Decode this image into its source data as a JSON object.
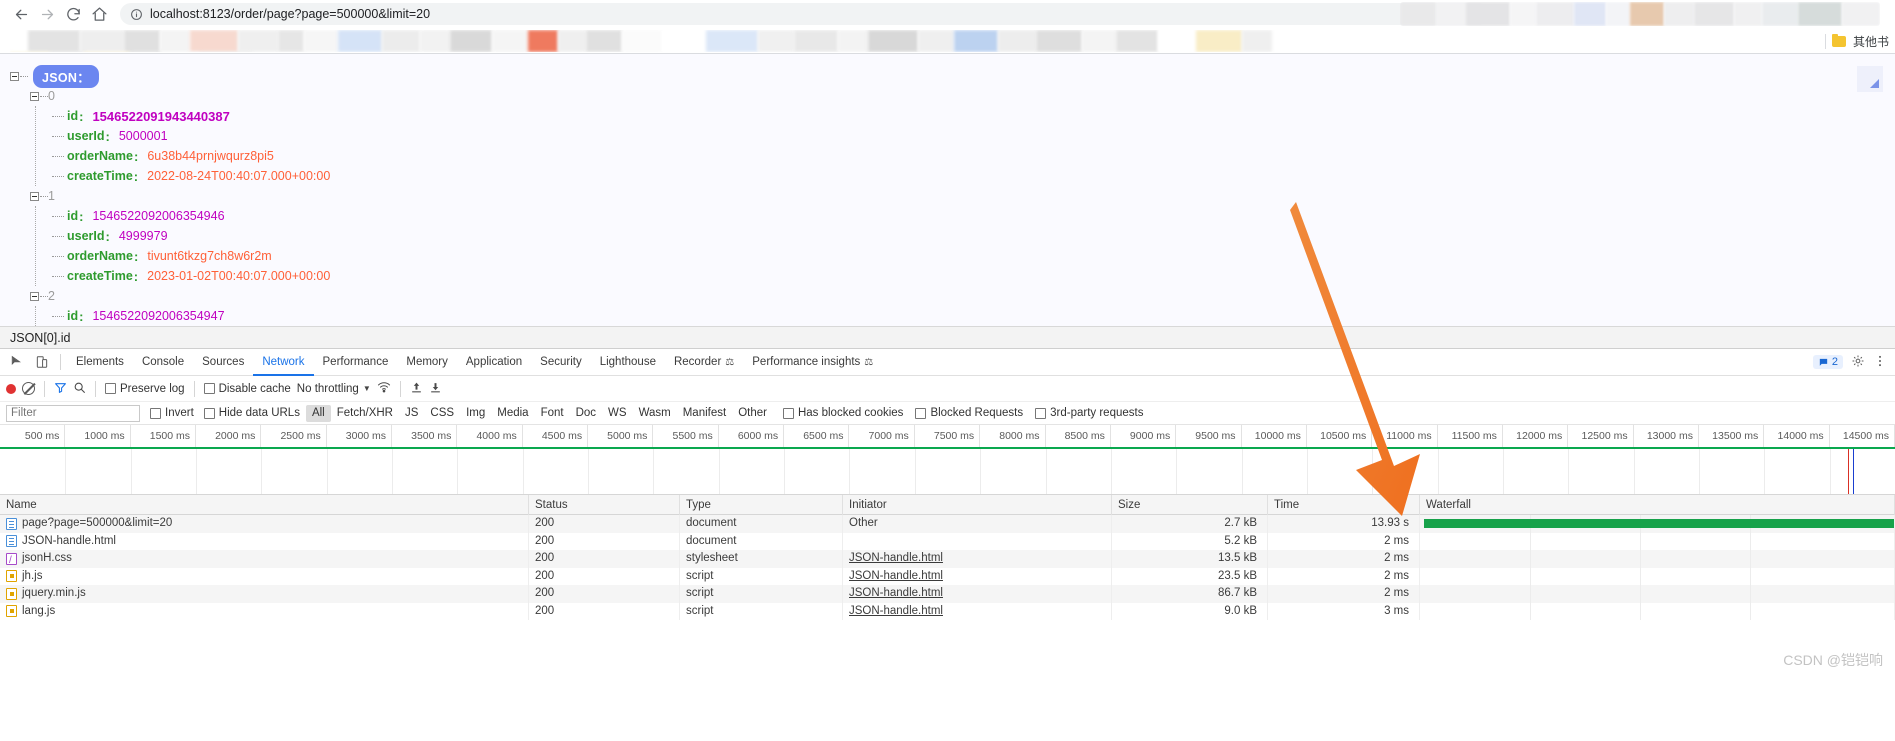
{
  "browser": {
    "back_label": "Back",
    "forward_label": "Forward",
    "reload_label": "Reload",
    "home_label": "Home",
    "site_info_label": "View site information",
    "url_host": "localhost:8123",
    "url_path": "/order/page?page=500000&limit=20",
    "url_full": "localhost:8123/order/page?page=500000&limit=20",
    "bookmarks_other_label": "其他书"
  },
  "json_viewer": {
    "root_label": "JSON：",
    "entries": [
      {
        "index": "0",
        "fields": [
          {
            "key": "id",
            "value": "1546522091943440387",
            "type": "number"
          },
          {
            "key": "userId",
            "value": "5000001",
            "type": "number"
          },
          {
            "key": "orderName",
            "value": "6u38b44prnjwqurz8pi5",
            "type": "string"
          },
          {
            "key": "createTime",
            "value": "2022-08-24T00:40:07.000+00:00",
            "type": "string"
          }
        ]
      },
      {
        "index": "1",
        "fields": [
          {
            "key": "id",
            "value": "1546522092006354946",
            "type": "number"
          },
          {
            "key": "userId",
            "value": "4999979",
            "type": "number"
          },
          {
            "key": "orderName",
            "value": "tivunt6tkzg7ch8w6r2m",
            "type": "string"
          },
          {
            "key": "createTime",
            "value": "2023-01-02T00:40:07.000+00:00",
            "type": "string"
          }
        ]
      },
      {
        "index": "2",
        "fields": [
          {
            "key": "id",
            "value": "1546522092006354947",
            "type": "number"
          }
        ]
      }
    ],
    "status_path": "JSON[0].id"
  },
  "devtools": {
    "tabs": [
      {
        "label": "Elements",
        "active": false
      },
      {
        "label": "Console",
        "active": false
      },
      {
        "label": "Sources",
        "active": false
      },
      {
        "label": "Network",
        "active": true
      },
      {
        "label": "Performance",
        "active": false
      },
      {
        "label": "Memory",
        "active": false
      },
      {
        "label": "Application",
        "active": false
      },
      {
        "label": "Security",
        "active": false
      },
      {
        "label": "Lighthouse",
        "active": false
      },
      {
        "label": "Recorder",
        "active": false,
        "badge": "⚗"
      },
      {
        "label": "Performance insights",
        "active": false,
        "badge": "⚗"
      }
    ],
    "warning_count": "2",
    "inspect_label": "Inspect element",
    "device_toolbar_label": "Toggle device toolbar",
    "settings_label": "Settings",
    "more_label": "More options"
  },
  "network_toolbar": {
    "record_label": "Stop recording network log",
    "clear_label": "Clear network log",
    "filter_toggle_label": "Filter",
    "search_label": "Search",
    "preserve_log": "Preserve log",
    "disable_cache": "Disable cache",
    "throttling": "No throttling",
    "import_label": "Import HAR file",
    "export_label": "Export HAR file"
  },
  "filter_bar": {
    "filter_placeholder": "Filter",
    "filter_value": "",
    "invert": "Invert",
    "hide_data_urls": "Hide data URLs",
    "types": [
      "All",
      "Fetch/XHR",
      "JS",
      "CSS",
      "Img",
      "Media",
      "Font",
      "Doc",
      "WS",
      "Wasm",
      "Manifest",
      "Other"
    ],
    "selected_type": "All",
    "has_blocked_cookies": "Has blocked cookies",
    "blocked_requests": "Blocked Requests",
    "third_party_requests": "3rd-party requests"
  },
  "timeline": {
    "ticks": [
      "500 ms",
      "1000 ms",
      "1500 ms",
      "2000 ms",
      "2500 ms",
      "3000 ms",
      "3500 ms",
      "4000 ms",
      "4500 ms",
      "5000 ms",
      "5500 ms",
      "6000 ms",
      "6500 ms",
      "7000 ms",
      "7500 ms",
      "8000 ms",
      "8500 ms",
      "9000 ms",
      "9500 ms",
      "10000 ms",
      "10500 ms",
      "11000 ms",
      "11500 ms",
      "12000 ms",
      "12500 ms",
      "13000 ms",
      "13500 ms",
      "14000 ms",
      "14500 ms"
    ]
  },
  "network_table": {
    "columns": [
      "Name",
      "Status",
      "Type",
      "Initiator",
      "Size",
      "Time",
      "Waterfall"
    ],
    "rows": [
      {
        "name": "page?page=500000&limit=20",
        "icon": "document-icon",
        "status": "200",
        "type": "document",
        "initiator": "Other",
        "initiator_link": false,
        "size": "2.7 kB",
        "time": "13.93 s",
        "bar": true
      },
      {
        "name": "JSON-handle.html",
        "icon": "document-icon",
        "status": "200",
        "type": "document",
        "initiator": "",
        "initiator_link": false,
        "size": "5.2 kB",
        "time": "2 ms",
        "bar": false
      },
      {
        "name": "jsonH.css",
        "icon": "stylesheet-icon",
        "status": "200",
        "type": "stylesheet",
        "initiator": "JSON-handle.html",
        "initiator_link": true,
        "size": "13.5 kB",
        "time": "2 ms",
        "bar": false
      },
      {
        "name": "jh.js",
        "icon": "script-icon",
        "status": "200",
        "type": "script",
        "initiator": "JSON-handle.html",
        "initiator_link": true,
        "size": "23.5 kB",
        "time": "2 ms",
        "bar": false
      },
      {
        "name": "jquery.min.js",
        "icon": "script-icon",
        "status": "200",
        "type": "script",
        "initiator": "JSON-handle.html",
        "initiator_link": true,
        "size": "86.7 kB",
        "time": "2 ms",
        "bar": false
      },
      {
        "name": "lang.js",
        "icon": "script-icon",
        "status": "200",
        "type": "script",
        "initiator": "JSON-handle.html",
        "initiator_link": true,
        "size": "9.0 kB",
        "time": "3 ms",
        "bar": false
      }
    ]
  },
  "watermark": "CSDN @铠铠响",
  "colors": {
    "accent": "#1a73e8",
    "json_badge": "#6b86f0",
    "key_green": "#2e9b2e",
    "number_magenta": "#c000c0",
    "string_orange": "#ff6038",
    "waterfall_green": "#17a24a",
    "arrow_orange": "#ef7325",
    "record_red": "#e03232"
  }
}
